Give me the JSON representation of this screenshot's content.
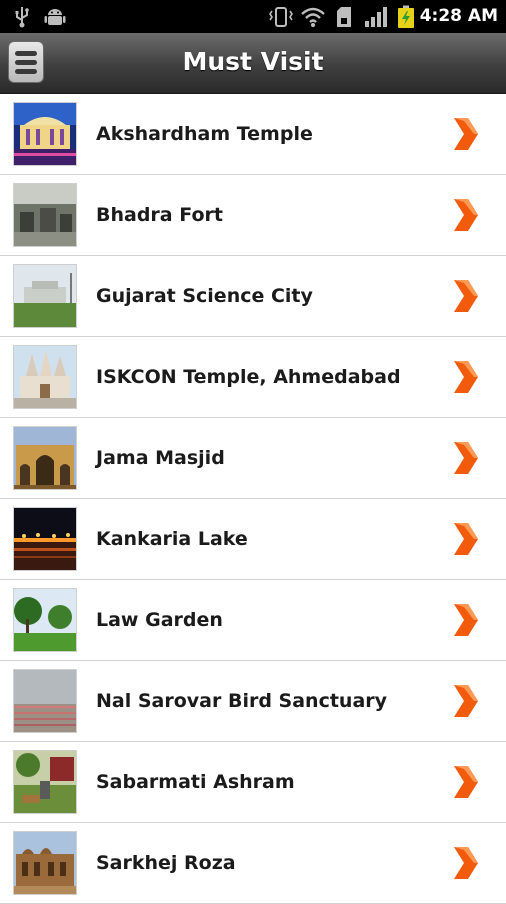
{
  "status_bar": {
    "time": "4:28 AM",
    "icons": [
      "usb-icon",
      "android-icon",
      "vibrate-icon",
      "wifi-icon",
      "sd-card-icon",
      "signal-icon",
      "battery-icon"
    ]
  },
  "header": {
    "title": "Must Visit",
    "menu_icon": "menu-icon"
  },
  "places": [
    {
      "name": "Akshardham Temple",
      "thumb": "temple-night-photo"
    },
    {
      "name": "Bhadra Fort",
      "thumb": "fort-photo"
    },
    {
      "name": "Gujarat Science City",
      "thumb": "science-city-photo"
    },
    {
      "name": "ISKCON Temple, Ahmedabad",
      "thumb": "iskcon-temple-photo"
    },
    {
      "name": "Jama Masjid",
      "thumb": "mosque-photo"
    },
    {
      "name": "Kankaria Lake",
      "thumb": "lake-night-photo"
    },
    {
      "name": "Law Garden",
      "thumb": "garden-photo"
    },
    {
      "name": "Nal Sarovar Bird Sanctuary",
      "thumb": "bird-sanctuary-photo"
    },
    {
      "name": "Sabarmati Ashram",
      "thumb": "ashram-photo"
    },
    {
      "name": "Sarkhej Roza",
      "thumb": "sarkhej-roza-photo"
    }
  ],
  "colors": {
    "chevron": "#f25a0c",
    "header_bg": "#3f3f3f",
    "status_bg": "#000000"
  }
}
